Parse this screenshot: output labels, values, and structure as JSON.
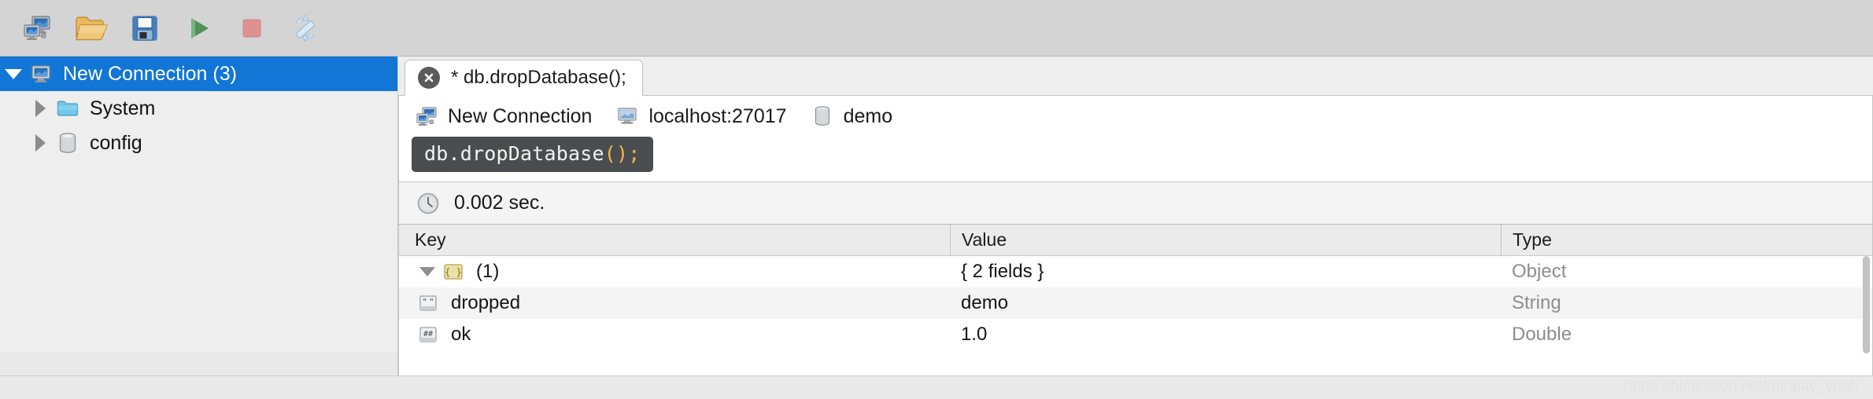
{
  "toolbar": {
    "buttons": [
      {
        "name": "new-connection-button",
        "label": "Connect",
        "icon": "computers-icon"
      },
      {
        "name": "open-script-button",
        "label": "Open Script",
        "icon": "folder-open-icon"
      },
      {
        "name": "save-script-button",
        "label": "Save Script",
        "icon": "floppy-disk-icon"
      },
      {
        "name": "execute-button",
        "label": "Execute",
        "icon": "play-icon"
      },
      {
        "name": "stop-button",
        "label": "Stop",
        "icon": "stop-square-icon"
      },
      {
        "name": "refresh-button",
        "label": "Refresh",
        "icon": "refresh-arrows-icon"
      }
    ]
  },
  "sidebar": {
    "items": [
      {
        "label": "New Connection (3)",
        "icon": "computer-icon",
        "expanded": true,
        "selected": true,
        "level": 0
      },
      {
        "label": "System",
        "icon": "folder-icon",
        "expanded": false,
        "selected": false,
        "level": 1
      },
      {
        "label": "config",
        "icon": "database-icon",
        "expanded": false,
        "selected": false,
        "level": 1
      }
    ]
  },
  "tabs": [
    {
      "label": "* db.dropDatabase();",
      "active": true,
      "close_icon": "close-circle-icon"
    }
  ],
  "breadcrumb": [
    {
      "label": "New Connection",
      "icon": "computers-icon"
    },
    {
      "label": "localhost:27017",
      "icon": "computer-icon"
    },
    {
      "label": "demo",
      "icon": "database-icon"
    }
  ],
  "editor": {
    "code_prefix": "db.dropDatabase",
    "code_paren": "()",
    "code_semi": ";",
    "full_text": "db.dropDatabase();"
  },
  "status": {
    "icon": "clock-icon",
    "time": "0.002 sec."
  },
  "results": {
    "columns": [
      "Key",
      "Value",
      "Type"
    ],
    "rows": [
      {
        "key": "(1)",
        "value": "{ 2 fields }",
        "type": "Object",
        "icon": "object-braces-icon",
        "expander": "triangle-down",
        "level": 0
      },
      {
        "key": "dropped",
        "value": "demo",
        "type": "String",
        "icon": "string-quotes-icon",
        "expander": "none",
        "level": 1
      },
      {
        "key": "ok",
        "value": "1.0",
        "type": "Double",
        "icon": "number-hash-icon",
        "expander": "none",
        "level": 1
      }
    ]
  },
  "footer": {
    "watermark": "https://blog.csdn.net/mirajay_yeah"
  },
  "colors": {
    "selection_blue": "#1176d6",
    "editor_bg": "#4a4d50",
    "accent_orange": "#f0b84b",
    "toolbar_bg": "#d4d4d4"
  }
}
